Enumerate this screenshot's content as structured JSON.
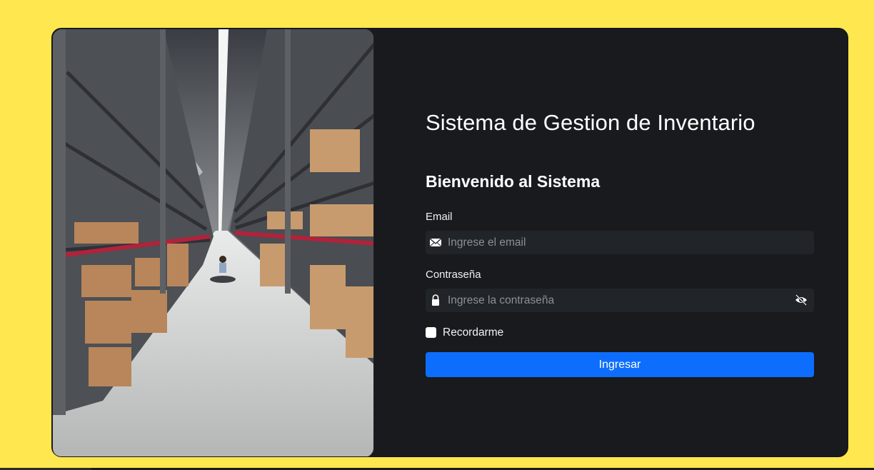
{
  "login": {
    "title": "Sistema de Gestion de Inventario",
    "subtitle": "Bienvenido al Sistema",
    "email_label": "Email",
    "email_placeholder": "Ingrese el email",
    "email_value": "",
    "email_icon": "envelope-icon",
    "password_label": "Contraseña",
    "password_placeholder": "Ingrese la contraseña",
    "password_value": "",
    "password_icon": "lock-icon",
    "toggle_icon": "eye-slash-icon",
    "remember_label": "Recordarme",
    "remember_checked": false,
    "submit_label": "Ingresar"
  },
  "colors": {
    "background": "#ffe74f",
    "card": "#181a1d",
    "input": "#212529",
    "primary": "#0d6efd"
  },
  "hero_image": "warehouse-aisle-photo"
}
